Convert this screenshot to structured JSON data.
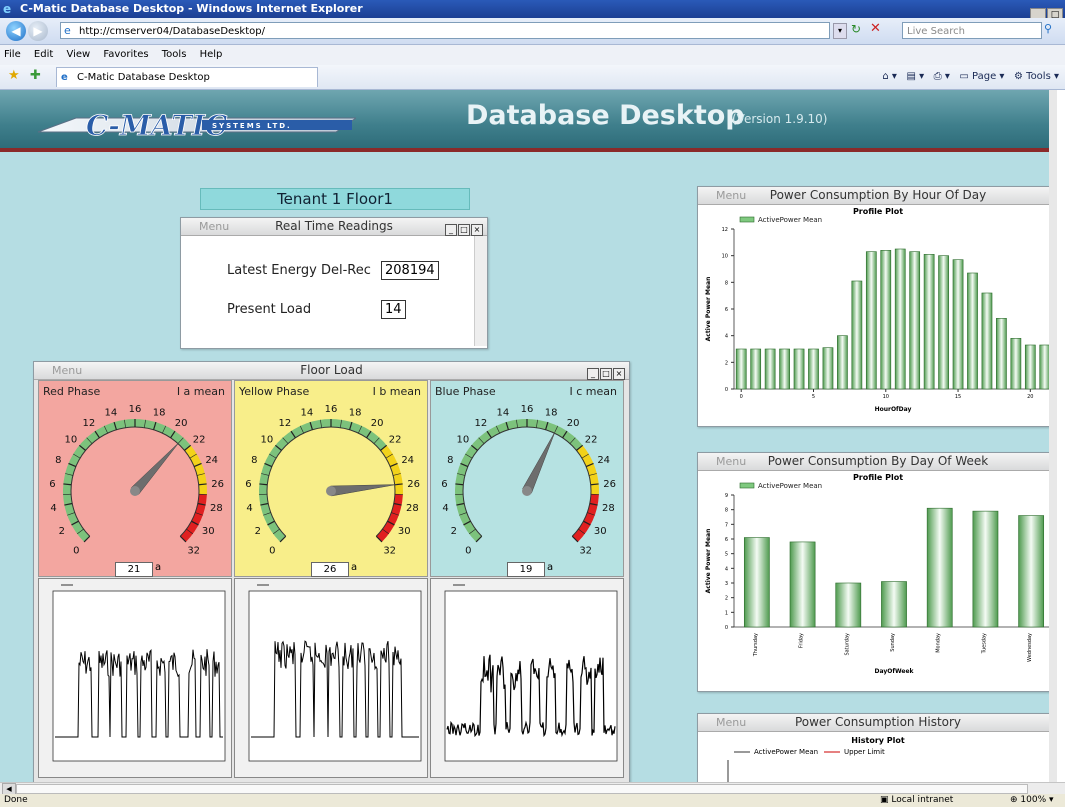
{
  "browser": {
    "window_title": "C-Matic Database Desktop - Windows Internet Explorer",
    "address": "http://cmserver04/DatabaseDesktop/",
    "search_placeholder": "Live Search",
    "menu": [
      "File",
      "Edit",
      "View",
      "Favorites",
      "Tools",
      "Help"
    ],
    "tab_title": "C-Matic Database Desktop",
    "cmd": {
      "page": "Page",
      "tools": "Tools"
    },
    "status_left": "Done",
    "zone": "Local intranet",
    "zoom": "100%"
  },
  "header": {
    "logo_text": "C-MATIC",
    "logo_sub": "SYSTEMS LTD.",
    "title": "Database Desktop",
    "version": "(Version 1.9.10)"
  },
  "tenant": "Tenant 1 Floor1",
  "realtime": {
    "menu": "Menu",
    "title": "Real Time Readings",
    "energy_label": "Latest Energy Del-Rec",
    "energy_value": "208194",
    "load_label": "Present Load",
    "load_value": "14"
  },
  "floor": {
    "menu": "Menu",
    "title": "Floor Load",
    "gauges": [
      {
        "name": "Red Phase",
        "mean": "I a mean",
        "value": "21",
        "unit": "a",
        "color": "#f3a6a0"
      },
      {
        "name": "Yellow Phase",
        "mean": "I b mean",
        "value": "26",
        "unit": "a",
        "color": "#f8ee8a"
      },
      {
        "name": "Blue Phase",
        "mean": "I c mean",
        "value": "19",
        "unit": "a",
        "color": "#b6e2e2"
      }
    ],
    "gauge_ticks": [
      "0",
      "2",
      "4",
      "6",
      "8",
      "10",
      "12",
      "14",
      "16",
      "18",
      "20",
      "22",
      "24",
      "26",
      "28",
      "30",
      "32"
    ]
  },
  "hourly": {
    "menu": "Menu",
    "title": "Power Consumption By Hour Of Day",
    "chart_title": "Profile Plot",
    "legend": "ActivePower Mean",
    "ylabel": "Active Power Mean",
    "xlabel": "HourOfDay"
  },
  "daily": {
    "menu": "Menu",
    "title": "Power Consumption By Day Of Week",
    "chart_title": "Profile Plot",
    "legend": "ActivePower Mean",
    "ylabel": "Active Power Mean",
    "xlabel": "DayOfWeek"
  },
  "history": {
    "menu": "Menu",
    "title": "Power Consumption History",
    "chart_title": "History Plot",
    "legend1": "ActivePower Mean",
    "legend2": "Upper Limit"
  },
  "chart_data": [
    {
      "type": "bar",
      "title": "Profile Plot",
      "series": [
        {
          "name": "ActivePower Mean",
          "values": [
            3,
            3,
            3,
            3,
            3,
            3,
            3.1,
            4,
            8.1,
            10.3,
            10.4,
            10.5,
            10.3,
            10.1,
            10,
            9.7,
            8.7,
            7.2,
            5.3,
            3.8,
            3.3,
            3.3
          ]
        }
      ],
      "xlabel": "HourOfDay",
      "ylabel": "Active Power Mean",
      "ylim": [
        0,
        12
      ],
      "yticks": [
        "0",
        "2",
        "4",
        "6",
        "8",
        "10",
        "12"
      ],
      "xticks": [
        "0",
        "5",
        "10",
        "15",
        "20"
      ]
    },
    {
      "type": "bar",
      "title": "Profile Plot",
      "categories": [
        "Thursday",
        "Friday",
        "Saturday",
        "Sunday",
        "Monday",
        "Tuesday",
        "Wednesday"
      ],
      "series": [
        {
          "name": "ActivePower Mean",
          "values": [
            6.1,
            5.8,
            3,
            3.1,
            8.1,
            7.9,
            7.6
          ]
        }
      ],
      "xlabel": "DayOfWeek",
      "ylabel": "Active Power Mean",
      "ylim": [
        0,
        9
      ],
      "yticks": [
        "0",
        "1",
        "2",
        "3",
        "4",
        "5",
        "6",
        "7",
        "8",
        "9"
      ]
    }
  ]
}
